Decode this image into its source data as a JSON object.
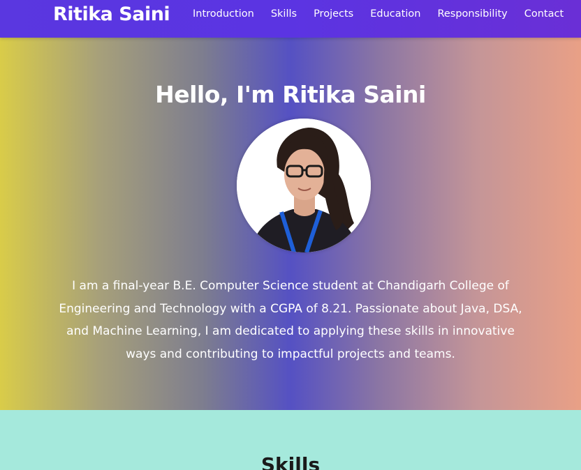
{
  "navbar": {
    "brand": "Ritika Saini",
    "links": [
      "Introduction",
      "Skills",
      "Projects",
      "Education",
      "Responsibility",
      "Contact"
    ]
  },
  "hero": {
    "title": "Hello, I'm Ritika Saini",
    "avatar_icon": "profile-photo",
    "intro": "I am a final-year B.E. Computer Science student at Chandigarh College of Engineering and Technology with a CGPA of 8.21. Passionate about Java, DSA, and Machine Learning, I am dedicated to applying these skills in innovative ways and contributing to impactful projects and teams."
  },
  "skills": {
    "title": "Skills"
  },
  "colors": {
    "navbar": "#5a37e0",
    "skills_bg": "#a5e9dc",
    "text_light": "#ffffff"
  }
}
